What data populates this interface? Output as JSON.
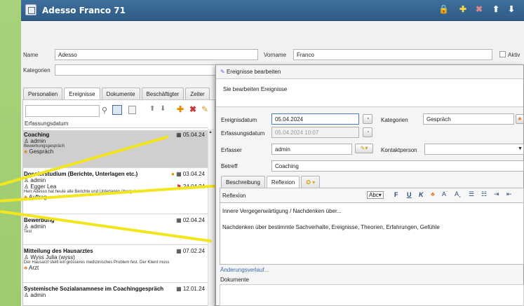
{
  "window": {
    "title": "Adesso Franco  71"
  },
  "person": {
    "name_label": "Name",
    "name_value": "Adesso",
    "vorname_label": "Vorname",
    "vorname_value": "Franco",
    "aktiv_label": "Aktiv",
    "kategorien_label": "Kategorien"
  },
  "tabs": [
    {
      "label": "Personalien"
    },
    {
      "label": "Ereignisse"
    },
    {
      "label": "Dokumente"
    },
    {
      "label": "Beschäftigter"
    },
    {
      "label": "Zeiter"
    }
  ],
  "list": {
    "column_header": "Erfassungsdatum",
    "items": [
      {
        "title": "Coaching",
        "date": "05.04.24",
        "user": "admin",
        "note": "Bewerbungsgespräch",
        "tag": "Gespräch"
      },
      {
        "title": "Dossierstudium (Berichte, Unterlagen etc.)",
        "date": "03.04.24",
        "user": "admin",
        "user2": "Egger Lea",
        "date2": "24.04.24",
        "note": "Herr Adesso hat heute alle Berichte und Unterlagen übergeben.",
        "tag": "Auftrag"
      },
      {
        "title": "Bewerbung",
        "date": "02.04.24",
        "user": "admin",
        "note": "Test"
      },
      {
        "title": "Mitteilung des Hausarztes",
        "date": "07.02.24",
        "user": "Wyss Julia (wyss)",
        "note": "Der Hausarzt stellt ein grösseres medizinisches Problem fest. Der Klient muss",
        "tag": "Arzt"
      },
      {
        "title": "Systemische Sozialanamnese im Coachinggespräch",
        "date": "12.01.24",
        "user": "admin"
      }
    ]
  },
  "dialog": {
    "title": "Ereignisse bearbeiten",
    "subtitle": "Sie bearbeiten Ereignisse",
    "ereignisdatum_label": "Ereignisdatum",
    "ereignisdatum_value": "05.04.2024",
    "erfassungsdatum_label": "Erfassungsdatum",
    "erfassungsdatum_value": "05.04.2024 10:07",
    "erfasser_label": "Erfasser",
    "erfasser_value": "admin",
    "kategorien_label": "Kategorien",
    "kategorien_value": "Gespräch",
    "kontaktperson_label": "Kontaktperson",
    "betreff_label": "Betreff",
    "betreff_value": "Coaching",
    "tab_beschreibung": "Beschreibung",
    "tab_reflexion": "Reflexion",
    "reflexion_label": "Reflexion",
    "reflexion_line1": "Innere Vergegenwärtigung / Nachdenken über...",
    "reflexion_line2": "Nachdenken über bestimmte Sachverhalte, Ereignisse, Theorien, Erfahrungen, Gefühle",
    "aenderungsverlauf": "Änderungsverlauf...",
    "dokumente": "Dokumente"
  },
  "colors": {
    "titlebar": "#3a6896",
    "selection": "#c9c9c9",
    "arrow": "#f3e51e"
  }
}
